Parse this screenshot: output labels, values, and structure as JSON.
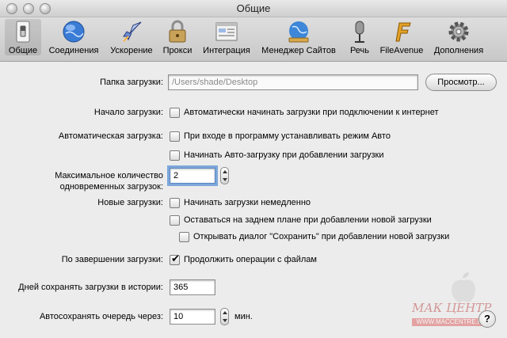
{
  "window": {
    "title": "Общие"
  },
  "toolbar": {
    "items": [
      {
        "label": "Общие",
        "icon": "switch-icon"
      },
      {
        "label": "Соединения",
        "icon": "globe-icon"
      },
      {
        "label": "Ускорение",
        "icon": "rocket-icon"
      },
      {
        "label": "Прокси",
        "icon": "padlock-icon"
      },
      {
        "label": "Интеграция",
        "icon": "window-integration-icon"
      },
      {
        "label": "Менеджер Сайтов",
        "icon": "site-manager-globe-icon"
      },
      {
        "label": "Речь",
        "icon": "microphone-icon"
      },
      {
        "label": "FileAvenue",
        "icon": "fileavenue-icon"
      },
      {
        "label": "Дополнения",
        "icon": "gear-icon"
      }
    ]
  },
  "download_folder": {
    "label": "Папка загрузки:",
    "path": "/Users/shade/Desktop",
    "browse_button": "Просмотр..."
  },
  "start_download": {
    "label": "Начало загрузки:",
    "option": "Автоматически начинать загрузки при подключении к интернет"
  },
  "auto_download": {
    "label": "Автоматическая загрузка:",
    "option1": "При входе в программу устанавливать режим Авто",
    "option2": "Начинать Авто-загрузку при добавлении загрузки"
  },
  "max_downloads": {
    "label": "Максимальное количество одновременных загрузок:",
    "value": "2"
  },
  "new_downloads": {
    "label": "Новые загрузки:",
    "option1": "Начинать загрузки немедленно",
    "option2": "Оставаться на заднем плане при добавлении новой загрузки",
    "option3": "Открывать диалог \"Сохранить\" при добавлении новой загрузки"
  },
  "on_complete": {
    "label": "По завершении загрузки:",
    "option": "Продолжить операции с файлам",
    "checked": true
  },
  "history_days": {
    "label": "Дней сохранять загрузки в истории:",
    "value": "365"
  },
  "autosave": {
    "label": "Автосохранять очередь через:",
    "value": "10",
    "unit": "мин."
  },
  "help": {
    "label": "?"
  },
  "watermark": {
    "text": "МАК ЦЕНТР",
    "url": "WWW.MACCENTRE.RU"
  }
}
